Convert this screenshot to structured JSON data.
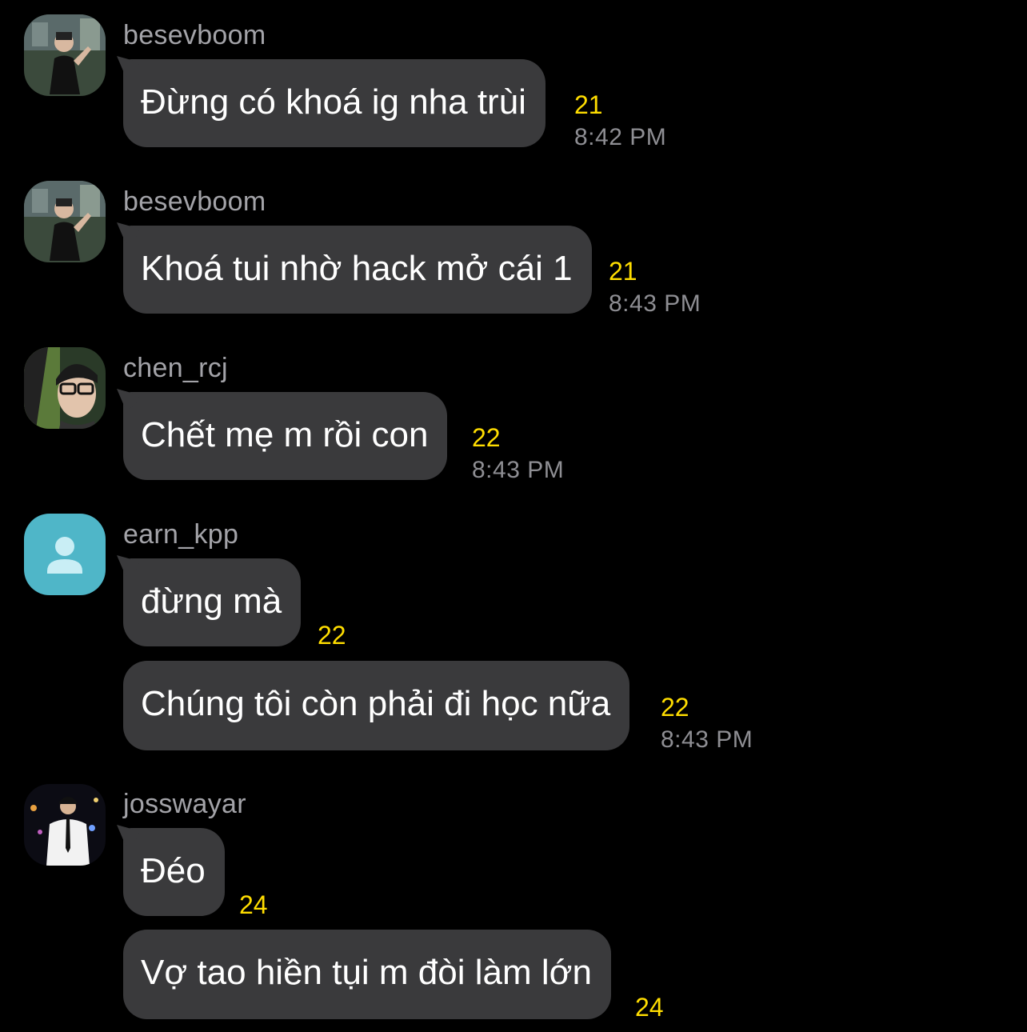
{
  "messages": [
    {
      "user": "besevboom",
      "text": "Đừng có khoá ig nha trùi",
      "count": "21",
      "time": "8:42 PM"
    },
    {
      "user": "besevboom",
      "text": "Khoá tui nhờ hack mở cái 1",
      "count": "21",
      "time": "8:43 PM"
    },
    {
      "user": "chen_rcj",
      "text": "Chết mẹ m rồi con",
      "count": "22",
      "time": "8:43 PM"
    },
    {
      "user": "earn_kpp",
      "text": "đừng mà",
      "count": "22"
    },
    {
      "text": "Chúng tôi còn phải đi học nữa",
      "count": "22",
      "time": "8:43 PM"
    },
    {
      "user": "josswayar",
      "text": "Đéo",
      "count": "24"
    },
    {
      "text": "Vợ tao hiền tụi m đòi làm lớn",
      "count": "24"
    }
  ],
  "colors": {
    "background": "#000000",
    "bubble": "#3a3a3c",
    "count": "#ffdd00",
    "username": "#a3a3a8",
    "timestamp": "#8e8e93",
    "default_avatar": "#4fb6c8"
  }
}
